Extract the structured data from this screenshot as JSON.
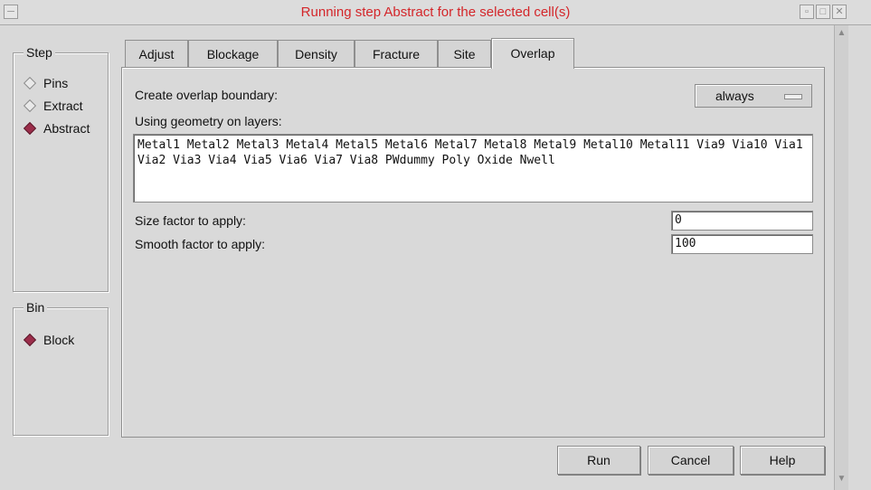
{
  "window": {
    "title": "Running step Abstract for the selected cell(s)",
    "menu_glyph": "─",
    "minimize_glyph": "▫",
    "maximize_glyph": "□",
    "close_glyph": "✕"
  },
  "step_group": {
    "legend": "Step",
    "options": [
      {
        "label": "Pins",
        "selected": false
      },
      {
        "label": "Extract",
        "selected": false
      },
      {
        "label": "Abstract",
        "selected": true
      }
    ]
  },
  "bin_group": {
    "legend": "Bin",
    "options": [
      {
        "label": "Block",
        "selected": true
      }
    ]
  },
  "tabs": [
    {
      "label": "Adjust",
      "active": false
    },
    {
      "label": "Blockage",
      "active": false
    },
    {
      "label": "Density",
      "active": false
    },
    {
      "label": "Fracture",
      "active": false
    },
    {
      "label": "Site",
      "active": false
    },
    {
      "label": "Overlap",
      "active": true
    }
  ],
  "overlap": {
    "create_boundary_label": "Create overlap boundary:",
    "create_boundary_value": "always",
    "layers_label": "Using geometry on layers:",
    "layers_value": "Metal1 Metal2 Metal3 Metal4 Metal5 Metal6 Metal7 Metal8 Metal9 Metal10 Metal11 Via9 Via10 Via1 Via2 Via3 Via4 Via5 Via6 Via7 Via8 PWdummy Poly Oxide Nwell",
    "size_factor_label": "Size factor to apply:",
    "size_factor_value": "0",
    "smooth_factor_label": "Smooth factor to apply:",
    "smooth_factor_value": "100"
  },
  "buttons": {
    "run": "Run",
    "cancel": "Cancel",
    "help": "Help"
  },
  "icons": {
    "scroll_up": "up-arrow-icon",
    "scroll_down": "down-arrow-icon",
    "up_glyph": "▲",
    "down_glyph": "▼"
  }
}
